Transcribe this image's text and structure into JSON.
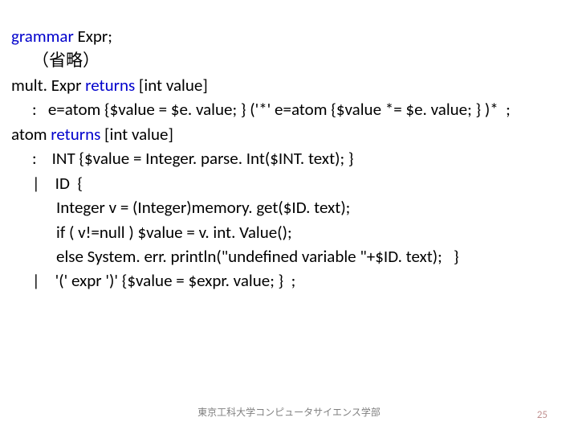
{
  "code": {
    "l1a": "grammar",
    "l1b": " Expr;",
    "l2": "（省略）",
    "l3a": "mult. Expr ",
    "l3b": "returns",
    "l3c": " [int value]",
    "l4": ":   e=atom {$value = $e. value; } ('*' e=atom {$value *= $e. value; } )*  ;",
    "l5a": "atom ",
    "l5b": "returns",
    "l5c": " [int value]",
    "l6": ":    INT {$value = Integer. parse. Int($INT. text); }",
    "l7": "|    ID  {",
    "l8": "Integer v = (Integer)memory. get($ID. text);",
    "l9": "if ( v!=null ) $value = v. int. Value();",
    "l10": "else System. err. println(\"undefined variable \"+$ID. text);   }",
    "l11": "|    '(' expr ')' {$value = $expr. value; }  ;"
  },
  "footer": "東京工科大学コンピュータサイエンス学部",
  "page": "25"
}
